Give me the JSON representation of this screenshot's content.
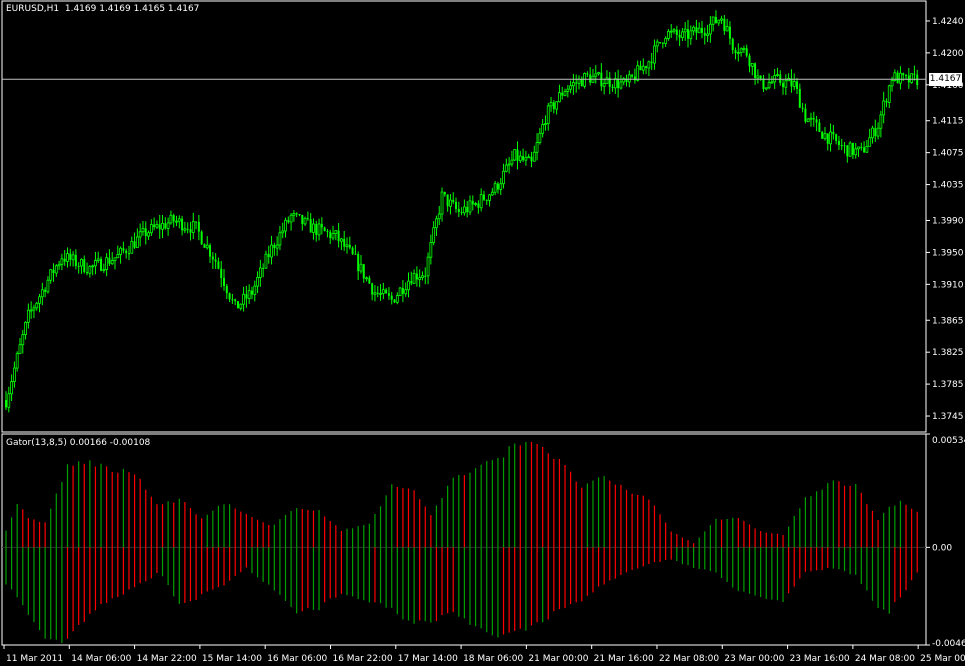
{
  "header": {
    "symbol": "EURUSD,H1",
    "ohlc": "1.4169 1.4169 1.4165 1.4167"
  },
  "indicator": {
    "title": "Gator(13,8,5) 0.00166 -0.00108"
  },
  "current_price": "1.4167",
  "colors": {
    "background": "#000000",
    "bull": "#00ff00",
    "bear": "#00ff00",
    "gator_up": "#00a000",
    "gator_down": "#ff0000",
    "grid_frame": "#ffffff",
    "price_line": "#c0c0c0"
  },
  "chart_data": [
    {
      "type": "candlestick",
      "title": "EURUSD,H1",
      "ylim": [
        1.3725,
        1.4265
      ],
      "y_ticks": [
        "1.4240",
        "1.4200",
        "1.4160",
        "1.4115",
        "1.4075",
        "1.4035",
        "1.3990",
        "1.3950",
        "1.3910",
        "1.3865",
        "1.3825",
        "1.3785",
        "1.3745"
      ],
      "x_ticks": [
        "11 Mar 2011",
        "14 Mar 06:00",
        "14 Mar 22:00",
        "15 Mar 14:00",
        "16 Mar 06:00",
        "16 Mar 22:00",
        "17 Mar 14:00",
        "18 Mar 06:00",
        "21 Mar 00:00",
        "21 Mar 16:00",
        "22 Mar 08:00",
        "23 Mar 00:00",
        "23 Mar 16:00",
        "24 Mar 08:00",
        "25 Mar 00:00"
      ],
      "close_path": [
        [
          0,
          1.3765
        ],
        [
          8,
          1.387
        ],
        [
          15,
          1.3915
        ],
        [
          20,
          1.3945
        ],
        [
          30,
          1.393
        ],
        [
          40,
          1.3945
        ],
        [
          50,
          1.3975
        ],
        [
          60,
          1.399
        ],
        [
          68,
          1.398
        ],
        [
          75,
          1.394
        ],
        [
          82,
          1.388
        ],
        [
          88,
          1.39
        ],
        [
          95,
          1.3955
        ],
        [
          102,
          1.3995
        ],
        [
          110,
          1.398
        ],
        [
          118,
          1.397
        ],
        [
          125,
          1.394
        ],
        [
          132,
          1.39
        ],
        [
          138,
          1.389
        ],
        [
          145,
          1.392
        ],
        [
          150,
          1.3925
        ],
        [
          156,
          1.402
        ],
        [
          162,
          1.4
        ],
        [
          168,
          1.401
        ],
        [
          175,
          1.403
        ],
        [
          182,
          1.407
        ],
        [
          188,
          1.406
        ],
        [
          193,
          1.412
        ],
        [
          200,
          1.4155
        ],
        [
          208,
          1.417
        ],
        [
          215,
          1.4165
        ],
        [
          222,
          1.416
        ],
        [
          230,
          1.419
        ],
        [
          236,
          1.4225
        ],
        [
          242,
          1.422
        ],
        [
          250,
          1.423
        ],
        [
          256,
          1.4245
        ],
        [
          260,
          1.421
        ],
        [
          265,
          1.42
        ],
        [
          270,
          1.416
        ],
        [
          276,
          1.4165
        ],
        [
          282,
          1.416
        ],
        [
          286,
          1.412
        ],
        [
          292,
          1.41
        ],
        [
          300,
          1.408
        ],
        [
          306,
          1.4075
        ],
        [
          312,
          1.411
        ],
        [
          317,
          1.417
        ],
        [
          322,
          1.4165
        ],
        [
          327,
          1.4167
        ]
      ],
      "n_candles": 327,
      "current_price": 1.4167
    },
    {
      "type": "histogram",
      "title": "Gator(13,8,5)",
      "upper_value": 0.00166,
      "lower_value": -0.00108,
      "ylim": [
        -0.0046,
        0.00534
      ],
      "y_ticks": [
        "0.00534",
        "0.00",
        "-0.0046"
      ],
      "upper_envelope": [
        [
          0,
          0.0008
        ],
        [
          4,
          0.0022
        ],
        [
          8,
          0.0014
        ],
        [
          14,
          0.0012
        ],
        [
          22,
          0.004
        ],
        [
          30,
          0.0042
        ],
        [
          38,
          0.0038
        ],
        [
          46,
          0.0036
        ],
        [
          55,
          0.002
        ],
        [
          62,
          0.0024
        ],
        [
          70,
          0.0014
        ],
        [
          78,
          0.0022
        ],
        [
          86,
          0.0016
        ],
        [
          95,
          0.001
        ],
        [
          104,
          0.002
        ],
        [
          112,
          0.0018
        ],
        [
          120,
          0.0008
        ],
        [
          130,
          0.0012
        ],
        [
          138,
          0.003
        ],
        [
          146,
          0.0028
        ],
        [
          152,
          0.0016
        ],
        [
          160,
          0.0034
        ],
        [
          168,
          0.0038
        ],
        [
          176,
          0.0044
        ],
        [
          184,
          0.0052
        ],
        [
          190,
          0.0052
        ],
        [
          198,
          0.0042
        ],
        [
          206,
          0.003
        ],
        [
          214,
          0.0034
        ],
        [
          222,
          0.0028
        ],
        [
          230,
          0.0024
        ],
        [
          238,
          0.0008
        ],
        [
          246,
          0.0002
        ],
        [
          254,
          0.0014
        ],
        [
          262,
          0.0014
        ],
        [
          270,
          0.0008
        ],
        [
          278,
          0.0006
        ],
        [
          286,
          0.0024
        ],
        [
          296,
          0.0032
        ],
        [
          304,
          0.003
        ],
        [
          312,
          0.0014
        ],
        [
          316,
          0.002
        ],
        [
          320,
          0.0022
        ],
        [
          327,
          0.0017
        ]
      ],
      "lower_envelope": [
        [
          0,
          -0.0018
        ],
        [
          6,
          -0.0028
        ],
        [
          14,
          -0.0044
        ],
        [
          22,
          -0.0046
        ],
        [
          30,
          -0.0032
        ],
        [
          38,
          -0.0026
        ],
        [
          46,
          -0.002
        ],
        [
          55,
          -0.0012
        ],
        [
          62,
          -0.0028
        ],
        [
          70,
          -0.0024
        ],
        [
          78,
          -0.0018
        ],
        [
          86,
          -0.001
        ],
        [
          95,
          -0.002
        ],
        [
          104,
          -0.0032
        ],
        [
          112,
          -0.003
        ],
        [
          120,
          -0.0022
        ],
        [
          130,
          -0.0026
        ],
        [
          138,
          -0.003
        ],
        [
          146,
          -0.0038
        ],
        [
          152,
          -0.0036
        ],
        [
          160,
          -0.0032
        ],
        [
          168,
          -0.004
        ],
        [
          176,
          -0.0044
        ],
        [
          184,
          -0.004
        ],
        [
          190,
          -0.0038
        ],
        [
          198,
          -0.003
        ],
        [
          206,
          -0.0026
        ],
        [
          214,
          -0.0018
        ],
        [
          222,
          -0.0012
        ],
        [
          230,
          -0.0008
        ],
        [
          238,
          -0.0006
        ],
        [
          246,
          -0.001
        ],
        [
          254,
          -0.0012
        ],
        [
          262,
          -0.0022
        ],
        [
          270,
          -0.0024
        ],
        [
          278,
          -0.0026
        ],
        [
          286,
          -0.0012
        ],
        [
          296,
          -0.001
        ],
        [
          304,
          -0.0014
        ],
        [
          312,
          -0.003
        ],
        [
          316,
          -0.0032
        ],
        [
          320,
          -0.0024
        ],
        [
          327,
          -0.0011
        ]
      ]
    }
  ]
}
